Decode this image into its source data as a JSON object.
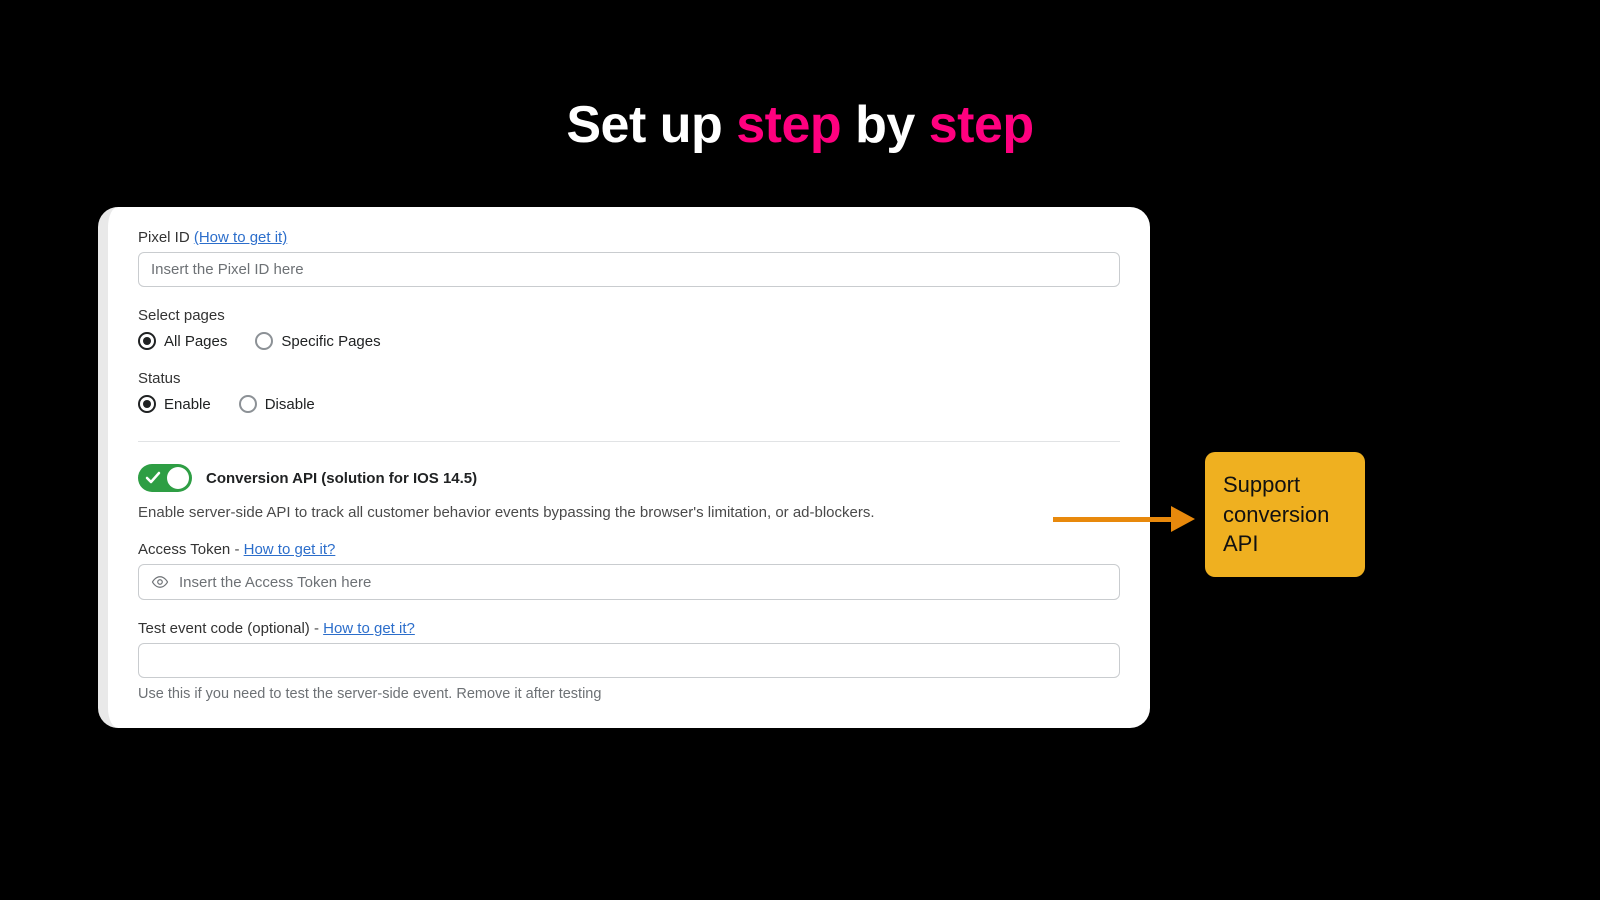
{
  "heading": {
    "part1": "Set up ",
    "part2": "step",
    "part3": " by ",
    "part4": "step"
  },
  "form": {
    "pixel": {
      "label": "Pixel ID ",
      "link": "(How to get it)",
      "placeholder": "Insert the Pixel ID here"
    },
    "pages": {
      "label": "Select pages",
      "opt_all": "All Pages",
      "opt_specific": "Specific Pages"
    },
    "status": {
      "label": "Status",
      "opt_enable": "Enable",
      "opt_disable": "Disable"
    },
    "capi": {
      "title": "Conversion API (solution for IOS 14.5)",
      "desc": "Enable server-side API to track all customer behavior events bypassing the browser's limitation, or ad-blockers."
    },
    "token": {
      "label": "Access Token",
      "sep": " - ",
      "link": "How to get it?",
      "placeholder": "Insert the Access Token here"
    },
    "testcode": {
      "label": "Test event code (optional)",
      "sep": " - ",
      "link": "How to get it?",
      "helper": "Use this if you need to test the server-side event. Remove it after testing"
    }
  },
  "callout": {
    "text": "Support conversion API"
  }
}
